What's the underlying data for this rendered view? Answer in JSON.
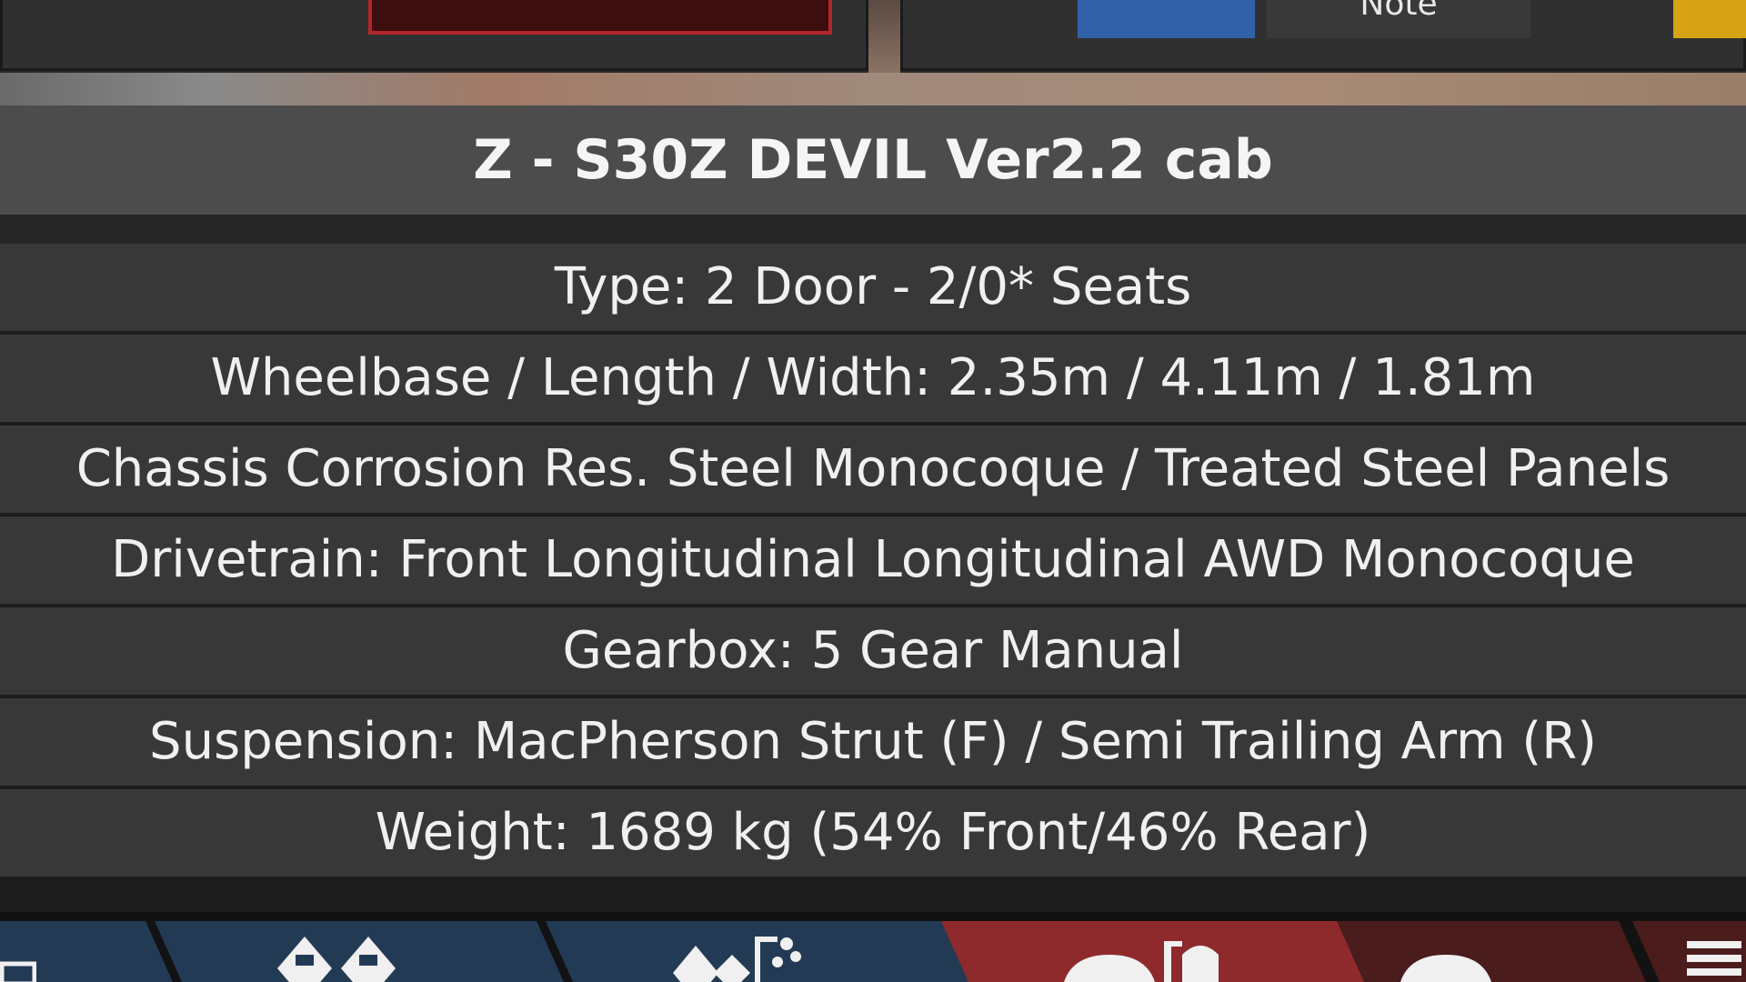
{
  "top_bar": {
    "note_label": "Note"
  },
  "car": {
    "title": "Z - S30Z DEVIL Ver2.2 cab"
  },
  "specs": [
    "Type: 2 Door - 2/0* Seats",
    "Wheelbase / Length / Width: 2.35m / 4.11m / 1.81m",
    "Chassis Corrosion Res. Steel Monocoque / Treated Steel Panels",
    "Drivetrain: Front Longitudinal Longitudinal AWD Monocoque",
    "Gearbox: 5 Gear Manual",
    "Suspension: MacPherson Strut (F) / Semi Trailing Arm (R)",
    "Weight: 1689 kg (54% Front/46% Rear)"
  ],
  "toolbar": {
    "tabs": [
      {
        "icon": "window-icon",
        "color": "#233a55"
      },
      {
        "icon": "cars-icon",
        "color": "#233a55"
      },
      {
        "icon": "cars-upgrade-icon",
        "color": "#233a55"
      },
      {
        "icon": "car-trim-icon",
        "color": "#8e2a2c"
      },
      {
        "icon": "car-icon",
        "color": "#4a1c1c"
      },
      {
        "icon": "list-icon",
        "color": "#4a1c1c"
      }
    ]
  },
  "colors": {
    "red_button": "#b3262b",
    "blue_button": "#3162a8",
    "yellow_button": "#d6a316",
    "row_bg": "#383838",
    "title_bg": "#4c4c4c"
  }
}
